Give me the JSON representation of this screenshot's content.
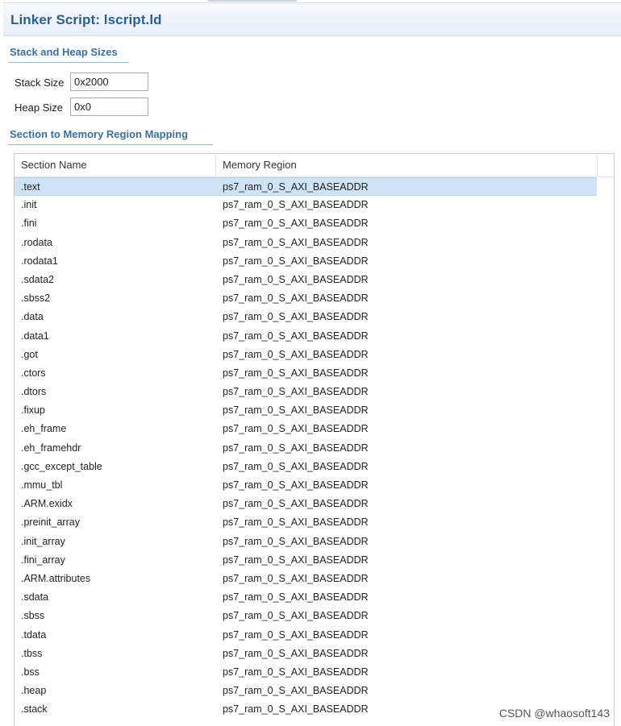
{
  "header": {
    "title": "Linker Script: lscript.ld"
  },
  "stack_heap": {
    "title": "Stack and Heap Sizes",
    "stack_label": "Stack Size",
    "stack_value": "0x2000",
    "heap_label": "Heap Size",
    "heap_value": "0x0"
  },
  "mapping": {
    "title": "Section to Memory Region Mapping",
    "columns": [
      "Section Name",
      "Memory Region"
    ],
    "selected_row": 0,
    "rows": [
      [
        ".text",
        "ps7_ram_0_S_AXI_BASEADDR"
      ],
      [
        ".init",
        "ps7_ram_0_S_AXI_BASEADDR"
      ],
      [
        ".fini",
        "ps7_ram_0_S_AXI_BASEADDR"
      ],
      [
        ".rodata",
        "ps7_ram_0_S_AXI_BASEADDR"
      ],
      [
        ".rodata1",
        "ps7_ram_0_S_AXI_BASEADDR"
      ],
      [
        ".sdata2",
        "ps7_ram_0_S_AXI_BASEADDR"
      ],
      [
        ".sbss2",
        "ps7_ram_0_S_AXI_BASEADDR"
      ],
      [
        ".data",
        "ps7_ram_0_S_AXI_BASEADDR"
      ],
      [
        ".data1",
        "ps7_ram_0_S_AXI_BASEADDR"
      ],
      [
        ".got",
        "ps7_ram_0_S_AXI_BASEADDR"
      ],
      [
        ".ctors",
        "ps7_ram_0_S_AXI_BASEADDR"
      ],
      [
        ".dtors",
        "ps7_ram_0_S_AXI_BASEADDR"
      ],
      [
        ".fixup",
        "ps7_ram_0_S_AXI_BASEADDR"
      ],
      [
        ".eh_frame",
        "ps7_ram_0_S_AXI_BASEADDR"
      ],
      [
        ".eh_framehdr",
        "ps7_ram_0_S_AXI_BASEADDR"
      ],
      [
        ".gcc_except_table",
        "ps7_ram_0_S_AXI_BASEADDR"
      ],
      [
        ".mmu_tbl",
        "ps7_ram_0_S_AXI_BASEADDR"
      ],
      [
        ".ARM.exidx",
        "ps7_ram_0_S_AXI_BASEADDR"
      ],
      [
        ".preinit_array",
        "ps7_ram_0_S_AXI_BASEADDR"
      ],
      [
        ".init_array",
        "ps7_ram_0_S_AXI_BASEADDR"
      ],
      [
        ".fini_array",
        "ps7_ram_0_S_AXI_BASEADDR"
      ],
      [
        ".ARM.attributes",
        "ps7_ram_0_S_AXI_BASEADDR"
      ],
      [
        ".sdata",
        "ps7_ram_0_S_AXI_BASEADDR"
      ],
      [
        ".sbss",
        "ps7_ram_0_S_AXI_BASEADDR"
      ],
      [
        ".tdata",
        "ps7_ram_0_S_AXI_BASEADDR"
      ],
      [
        ".tbss",
        "ps7_ram_0_S_AXI_BASEADDR"
      ],
      [
        ".bss",
        "ps7_ram_0_S_AXI_BASEADDR"
      ],
      [
        ".heap",
        "ps7_ram_0_S_AXI_BASEADDR"
      ],
      [
        ".stack",
        "ps7_ram_0_S_AXI_BASEADDR"
      ]
    ]
  },
  "watermark": "CSDN @whaosoft143"
}
